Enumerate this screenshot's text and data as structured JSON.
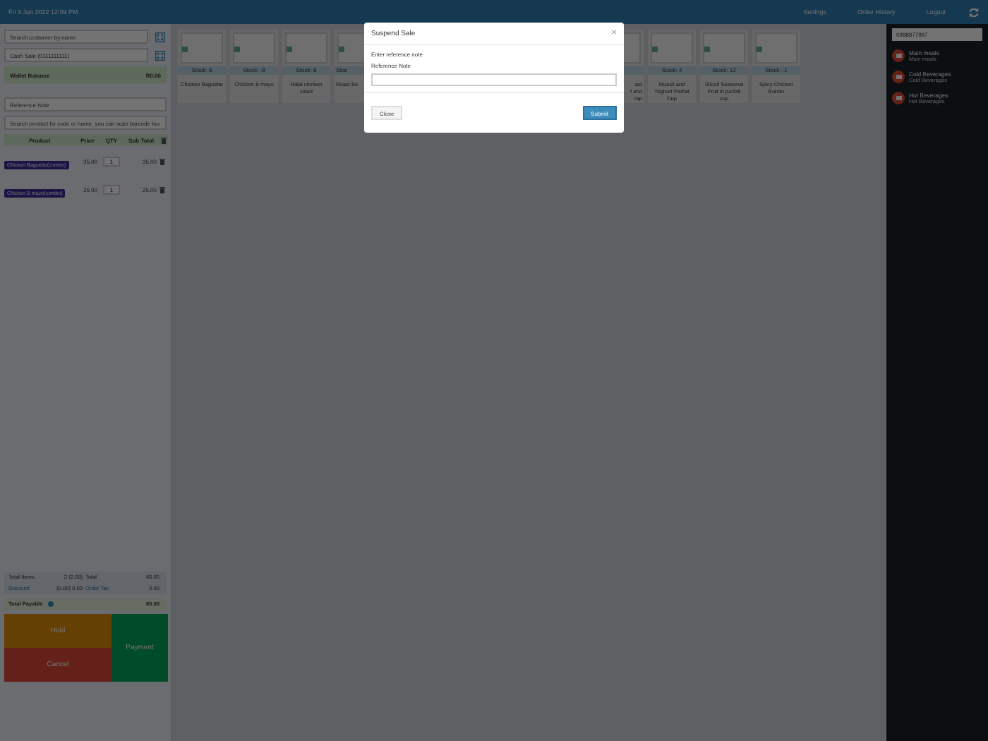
{
  "header": {
    "datetime": "Fri 3 Jun 2022 12:09 PM",
    "buttons": [
      "Settings",
      "Order History",
      "Logout"
    ]
  },
  "customer": {
    "search_placeholder": "Search customer by name",
    "selected": "Cash Sale (0111111111)",
    "wallet_label": "Wallet Balance",
    "wallet_value": "R0.00"
  },
  "reference_placeholder": "Reference Note",
  "product_search_placeholder": "Search product by code or name, you can scan barcode too",
  "cart": {
    "columns": [
      "Product",
      "Price",
      "QTY",
      "Sub Total"
    ],
    "rows": [
      {
        "product": "Chicken Baguette(combo)",
        "price": "35.00",
        "qty": "1",
        "subtotal": "35.00"
      },
      {
        "product": "Chicken & mayo(combo)",
        "price": "25.00",
        "qty": "1",
        "subtotal": "25.00"
      }
    ]
  },
  "totals": {
    "total_items_label": "Total Items",
    "total_items": "2 (2.00)",
    "total_label": "Total",
    "total": "60.00",
    "discount_label": "Discount",
    "discount": "(0.00) 0.00",
    "tax_label": "Order Tax",
    "tax": "0.00",
    "payable_label": "Total Payable",
    "payable": "60.00"
  },
  "actions": {
    "hold": "Hold",
    "cancel": "Cancel",
    "payment": "Payment"
  },
  "products": [
    {
      "kind": "card",
      "stock": "Stock: 8",
      "name": [
        "Chicken Baguette"
      ]
    },
    {
      "kind": "card",
      "stock": "Stock: -8",
      "name": [
        "Chicken & mayo"
      ]
    },
    {
      "kind": "card",
      "stock": "Stock: 8",
      "name": [
        "Halal chicken",
        "salad"
      ]
    },
    {
      "kind": "cut_right",
      "stock": "Stoc",
      "name": [
        "Roast Be"
      ]
    },
    {
      "kind": "hidden"
    },
    {
      "kind": "hidden"
    },
    {
      "kind": "hidden"
    },
    {
      "kind": "hidden"
    },
    {
      "kind": "cut_left",
      "name": [
        "ast",
        "f and",
        "rap"
      ]
    },
    {
      "kind": "card",
      "stock": "Stock: 4",
      "name": [
        "Muesli and",
        "Yoghurt Parfait",
        "Cup"
      ]
    },
    {
      "kind": "card",
      "stock": "Stock: 12",
      "name": [
        "Sliced Seasonal",
        "Fruit in parfait",
        "cup"
      ]
    },
    {
      "kind": "card",
      "stock": "Stock: -1",
      "name": [
        "Spicy Chicken",
        "Burrito"
      ]
    }
  ],
  "sidebar": {
    "search_value": "0998877997",
    "categories": [
      {
        "title": "Main meals",
        "subtitle": "Main meals"
      },
      {
        "title": "Cold Beverages",
        "subtitle": "Cold Beverages"
      },
      {
        "title": "Hot Beverages",
        "subtitle": "Hot Beverages"
      }
    ]
  },
  "modal": {
    "title": "Suspend Sale",
    "close_icon": "×",
    "prompt": "Enter reference note",
    "field_label": "Reference Note",
    "buttons": {
      "close": "Close",
      "submit": "Submit"
    }
  }
}
